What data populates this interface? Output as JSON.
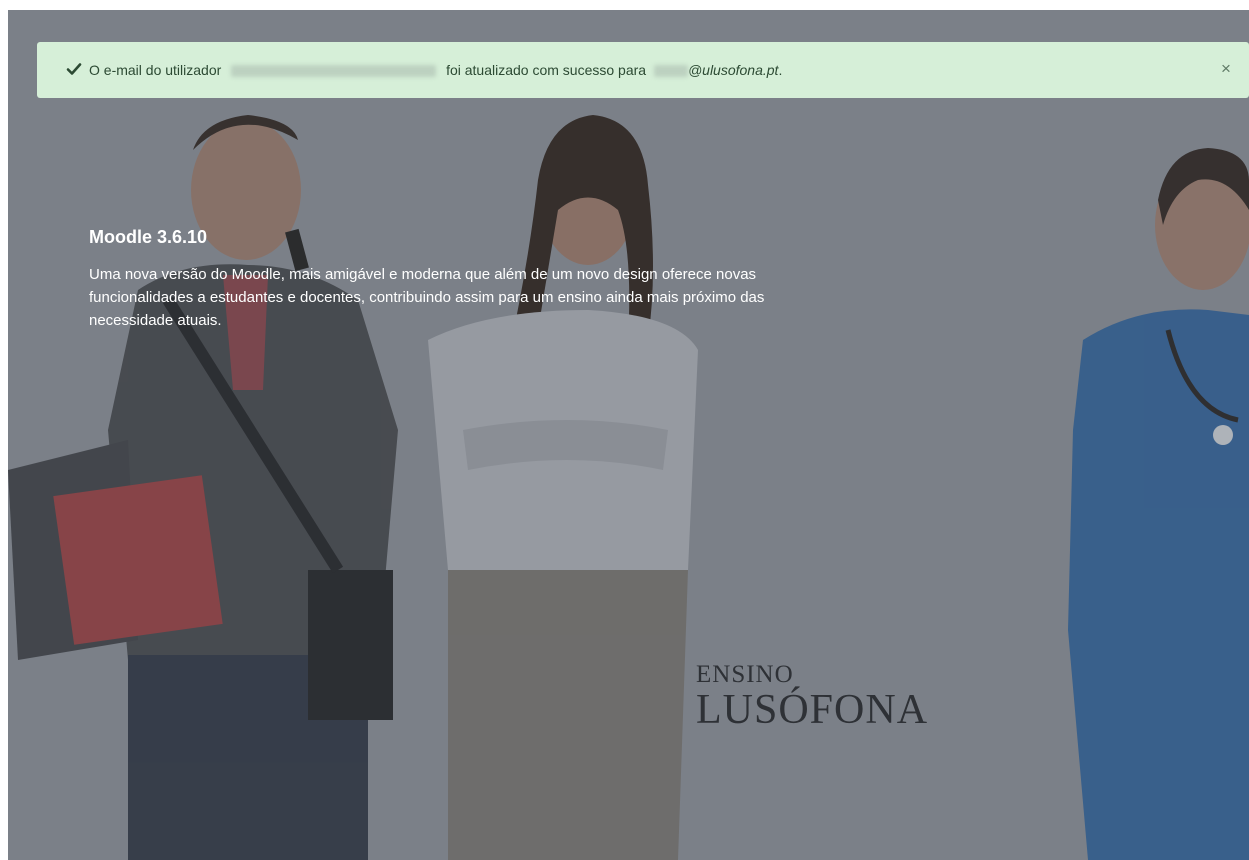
{
  "alert": {
    "icon": "check-icon",
    "prefix": "O e-mail do utilizador",
    "middle": "foi atualizado com sucesso para",
    "email_suffix": "@ulusofona.pt",
    "period": ".",
    "close_label": "×",
    "background": "#d6efd8"
  },
  "hero": {
    "title": "Moodle 3.6.10",
    "description": "Uma nova  versão do Moodle, mais amigável e moderna que além de um novo design oferece novas funcionalidades a estudantes e docentes, contribuindo assim para um ensino ainda mais próximo das necessidade atuais."
  },
  "brand": {
    "line1": "ENSINO",
    "line2": "LUSÓFONA"
  },
  "colors": {
    "overlay": "#7b8088",
    "text_on_hero": "#ffffff"
  }
}
